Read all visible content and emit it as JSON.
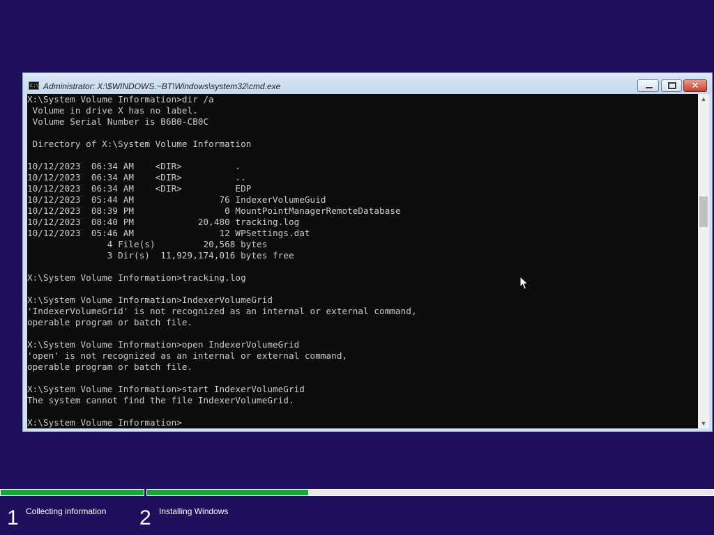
{
  "window": {
    "title": "Administrator: X:\\$WINDOWS.~BT\\Windows\\system32\\cmd.exe",
    "icon_text": "C:\\"
  },
  "console": {
    "lines": [
      "X:\\System Volume Information>dir /a",
      " Volume in drive X has no label.",
      " Volume Serial Number is B6B0-CB0C",
      "",
      " Directory of X:\\System Volume Information",
      "",
      "10/12/2023  06:34 AM    <DIR>          .",
      "10/12/2023  06:34 AM    <DIR>          ..",
      "10/12/2023  06:34 AM    <DIR>          EDP",
      "10/12/2023  05:44 AM                76 IndexerVolumeGuid",
      "10/12/2023  08:39 PM                 0 MountPointManagerRemoteDatabase",
      "10/12/2023  08:40 PM            20,480 tracking.log",
      "10/12/2023  05:46 AM                12 WPSettings.dat",
      "               4 File(s)         20,568 bytes",
      "               3 Dir(s)  11,929,174,016 bytes free",
      "",
      "X:\\System Volume Information>tracking.log",
      "",
      "X:\\System Volume Information>IndexerVolumeGrid",
      "'IndexerVolumeGrid' is not recognized as an internal or external command,",
      "operable program or batch file.",
      "",
      "X:\\System Volume Information>open IndexerVolumeGrid",
      "'open' is not recognized as an internal or external command,",
      "operable program or batch file.",
      "",
      "X:\\System Volume Information>start IndexerVolumeGrid",
      "The system cannot find the file IndexerVolumeGrid.",
      "",
      "X:\\System Volume Information>"
    ]
  },
  "setup": {
    "steps": [
      {
        "number": "1",
        "label": "Collecting information",
        "progress": 1.0
      },
      {
        "number": "2",
        "label": "Installing Windows",
        "progress": 0.284
      }
    ]
  },
  "icons": {
    "minimize": "minimize-icon",
    "maximize": "maximize-icon",
    "close": "close-icon",
    "close_glyph": "✕",
    "scroll_up_glyph": "▲",
    "scroll_down_glyph": "▼"
  },
  "colors": {
    "desktop": "#1f0f5c",
    "console_bg": "#0c0c0c",
    "console_text": "#cccccc",
    "progress_fill": "#17a638"
  }
}
